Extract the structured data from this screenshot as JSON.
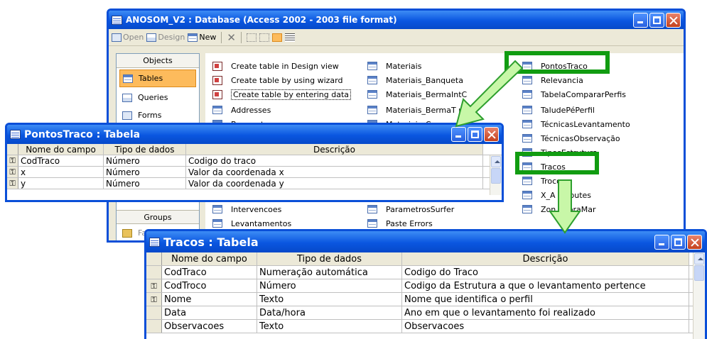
{
  "db_window": {
    "title": "ANOSOM_V2 : Database (Access 2002 - 2003 file format)",
    "toolbar": {
      "open": "Open",
      "design": "Design",
      "new": "New"
    },
    "objects_header": "Objects",
    "objects": [
      "Tables",
      "Queries",
      "Forms"
    ],
    "groups_header": "Groups",
    "favorites": "Favorites",
    "list_col1": [
      "Create table in Design view",
      "Create table by using wizard",
      "Create table by entering data",
      "Addresses",
      "Banqueta"
    ],
    "list_col1_bottom": [
      "Intervencoes",
      "Levantamentos"
    ],
    "list_col2": [
      "Materiais",
      "Materiais_Banqueta",
      "Materiais_BermaIntC",
      "Materiais_BermaT roa",
      "Materiais_Coroan"
    ],
    "list_col2_bottom": [
      "ParametrosSurfer",
      "Paste Errors"
    ],
    "list_col3": [
      "PontosTraco",
      "Relevancia",
      "TabelaCompararPerfis",
      "TaludePéPerfil",
      "TécnicasLevantamento",
      "TécnicasObservação",
      "TiposEstrutura",
      "Tracos",
      "Trocos",
      "X_A   ttributes",
      "Zon   uebraMar"
    ]
  },
  "pt_window": {
    "title": "PontosTraco : Tabela",
    "headers": [
      "Nome do campo",
      "Tipo de dados",
      "Descrição"
    ],
    "rows": [
      {
        "key": true,
        "name": "CodTraco",
        "type": "Número",
        "desc": "Codigo do traco"
      },
      {
        "key": true,
        "name": "x",
        "type": "Número",
        "desc": "Valor da coordenada x"
      },
      {
        "key": true,
        "name": "y",
        "type": "Número",
        "desc": "Valor da coordenada y"
      }
    ]
  },
  "tr_window": {
    "title": "Tracos : Tabela",
    "headers": [
      "Nome do campo",
      "Tipo de dados",
      "Descrição"
    ],
    "rows": [
      {
        "key": false,
        "name": "CodTraco",
        "type": "Numeração automática",
        "desc": "Codigo do Traco"
      },
      {
        "key": true,
        "name": "CodTroco",
        "type": "Número",
        "desc": "Codigo da Estrutura a que o levantamento pertence"
      },
      {
        "key": true,
        "name": "Nome",
        "type": "Texto",
        "desc": "Nome que identifica o perfil"
      },
      {
        "key": false,
        "name": "Data",
        "type": "Data/hora",
        "desc": "Ano em que o levantamento foi realizado"
      },
      {
        "key": false,
        "name": "Observacoes",
        "type": "Texto",
        "desc": "Observacoes"
      }
    ]
  },
  "colors": {
    "xp_blue": "#0a56e0",
    "highlight_green": "#119c11",
    "arrow_fill": "#c8f7a8"
  },
  "key_glyph": "⚿"
}
